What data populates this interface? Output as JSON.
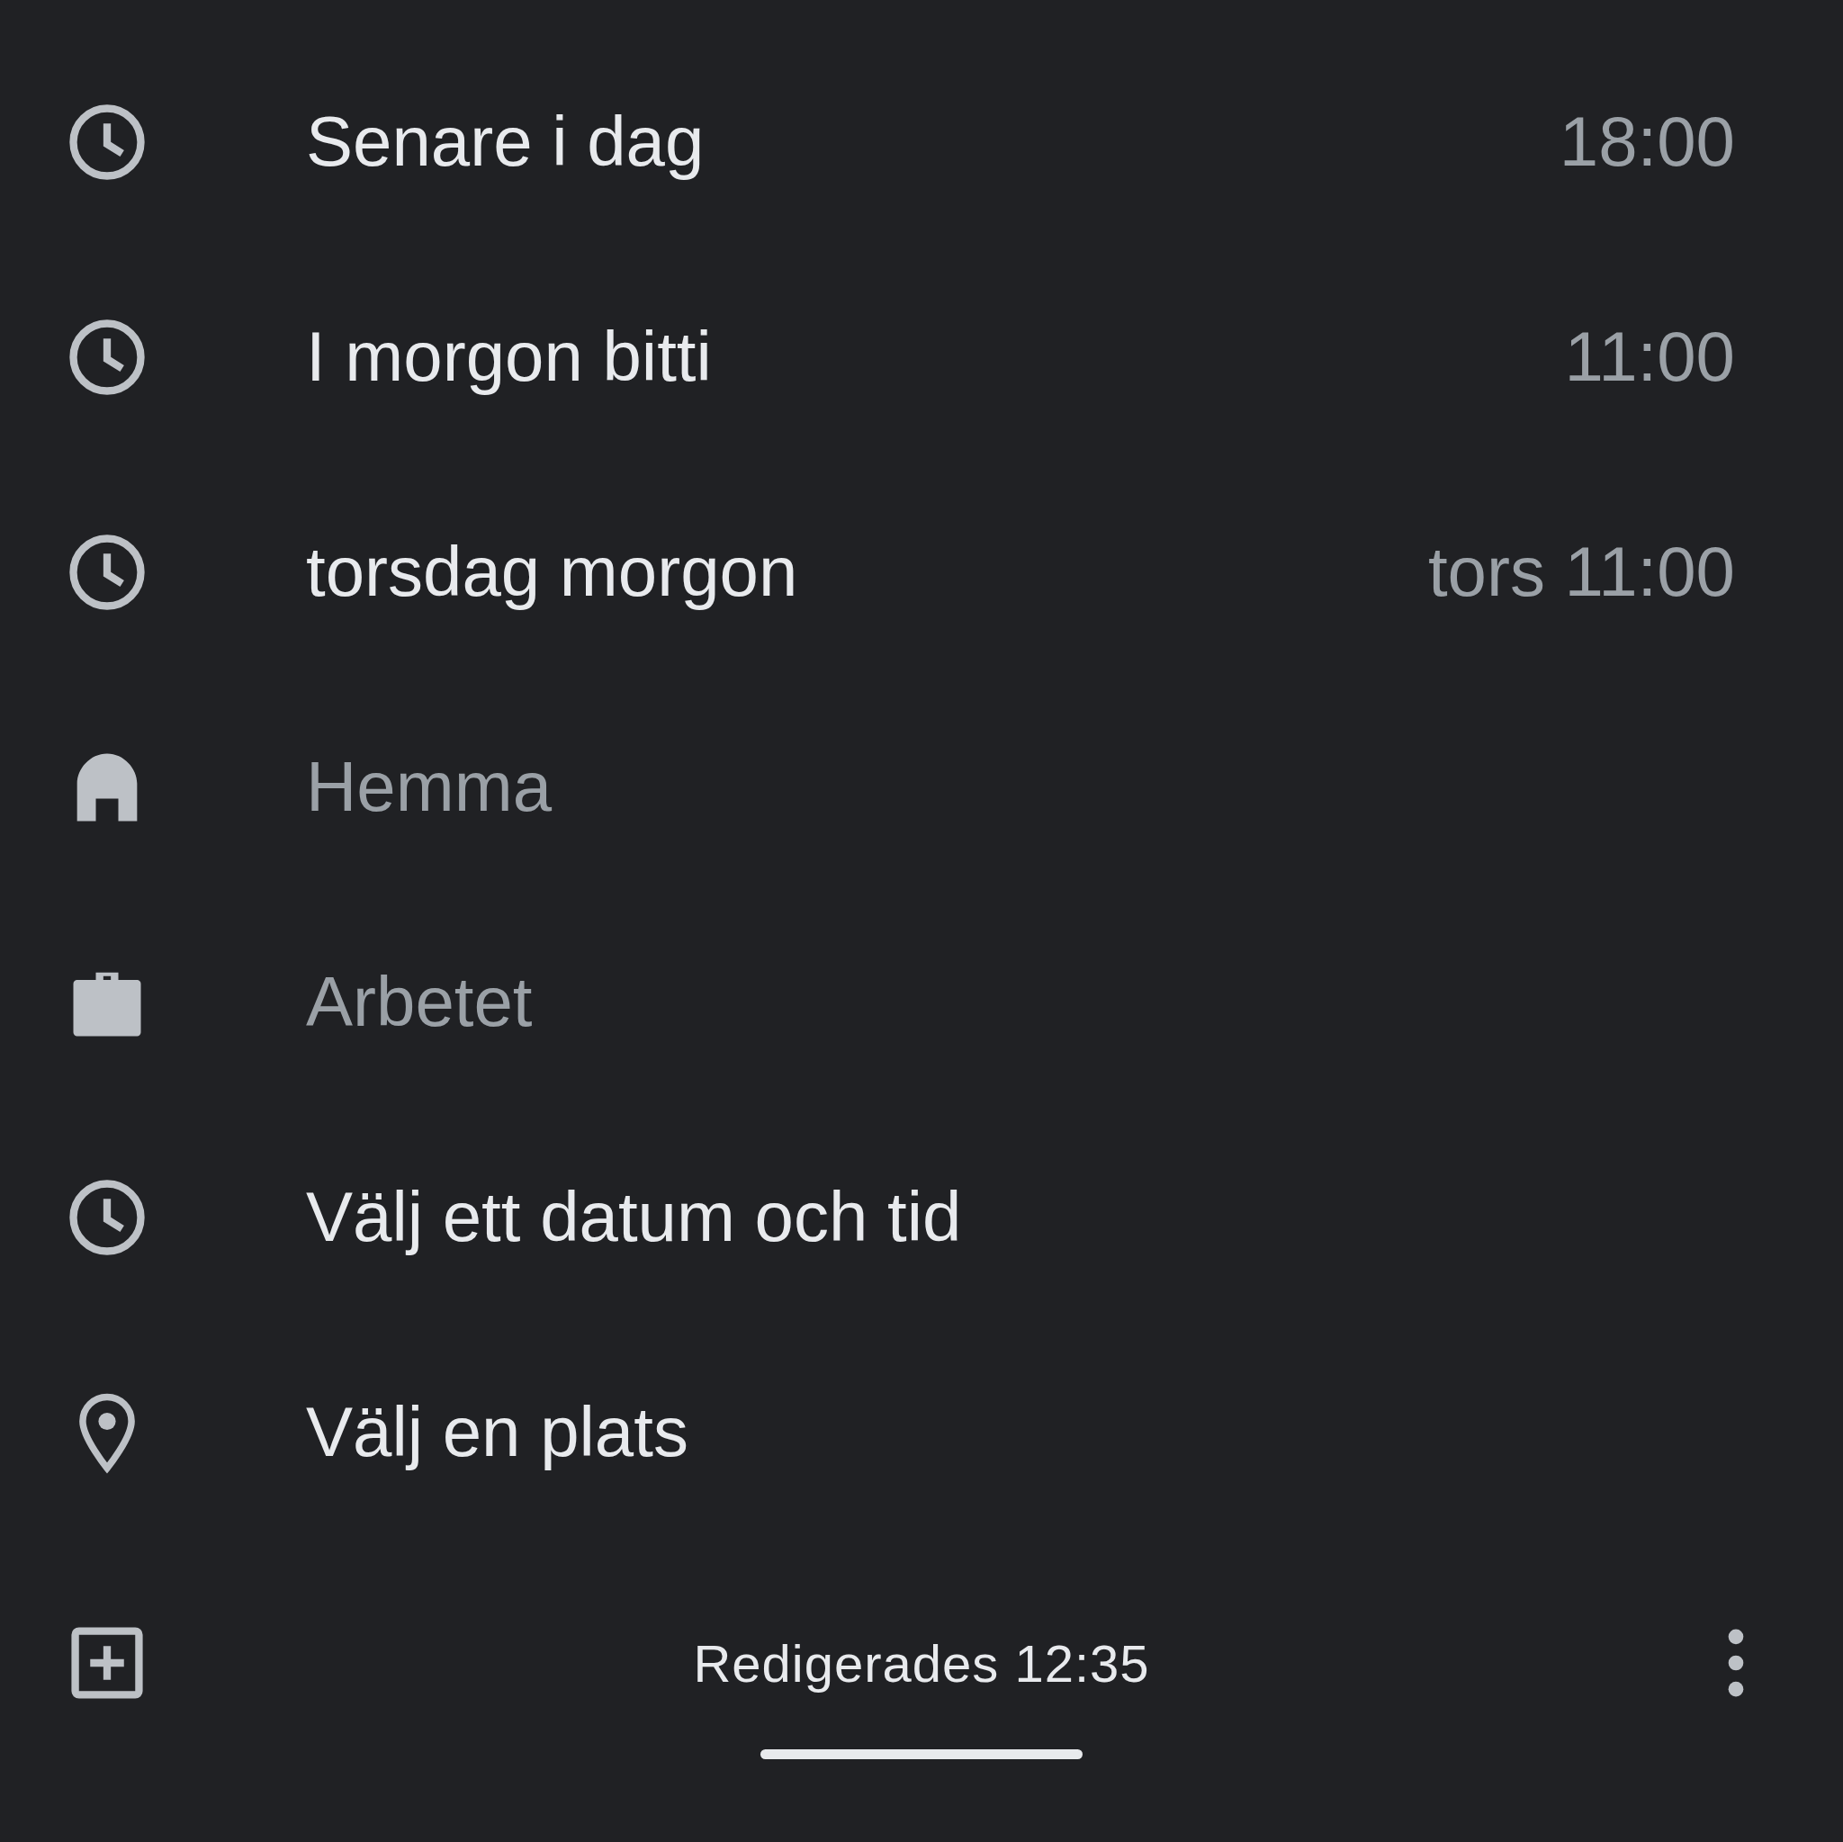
{
  "reminder_options": [
    {
      "kind": "time",
      "label": "Senare i dag",
      "time": "18:00",
      "disabled": false
    },
    {
      "kind": "time",
      "label": "I morgon bitti",
      "time": "11:00",
      "disabled": false
    },
    {
      "kind": "time",
      "label": "torsdag morgon",
      "time": "tors 11:00",
      "disabled": false
    },
    {
      "kind": "home",
      "label": "Hemma",
      "disabled": true
    },
    {
      "kind": "work",
      "label": "Arbetet",
      "disabled": true
    },
    {
      "kind": "datetime",
      "label": "Välj ett datum och tid",
      "disabled": false
    },
    {
      "kind": "place",
      "label": "Välj en plats",
      "disabled": false
    }
  ],
  "bottom_bar": {
    "status": "Redigerades 12:35"
  }
}
